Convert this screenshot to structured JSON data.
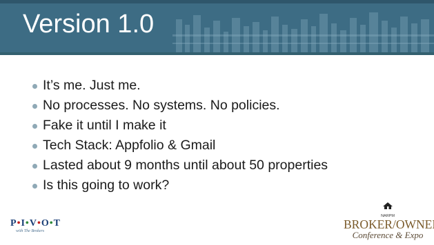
{
  "slide": {
    "title": "Version 1.0",
    "bullets": [
      "It’s me. Just me.",
      "No processes. No systems.  No policies.",
      "Fake it until I make it",
      "Tech Stack: Appfolio & Gmail",
      "Lasted about 9 months until about 50 properties",
      "Is this going to work?"
    ]
  },
  "footer": {
    "pivot_logo": {
      "word": "PIVOT",
      "tagline": "with The Brokers"
    },
    "broker_logo": {
      "narpm": "NARPM",
      "title": "BROKER/OWNER",
      "subtitle": "Conference & Expo"
    }
  },
  "colors": {
    "title_band": "#3f6f86",
    "bullet_dot": "#8fa9b6",
    "text": "#1a1a1a",
    "broker_gold": "#7a5a2a"
  }
}
